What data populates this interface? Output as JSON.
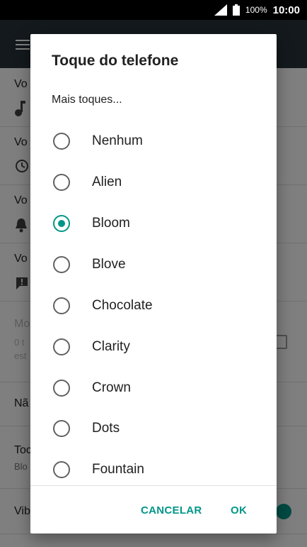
{
  "status_bar": {
    "battery": "100%",
    "time": "10:00"
  },
  "background": {
    "rows": [
      {
        "title": "Vo"
      },
      {
        "title": "Vo"
      },
      {
        "title": "Vo"
      },
      {
        "title": "Vo"
      },
      {
        "title": "Mo",
        "sub1": "0 t",
        "sub2": "est"
      },
      {
        "title": "Nã"
      },
      {
        "title": "Toc",
        "sub1": "Blo"
      },
      {
        "title": "Vib"
      }
    ]
  },
  "dialog": {
    "title": "Toque do telefone",
    "more_tones": "Mais toques...",
    "options": [
      {
        "label": "Nenhum",
        "checked": false
      },
      {
        "label": "Alien",
        "checked": false
      },
      {
        "label": "Bloom",
        "checked": true
      },
      {
        "label": "Blove",
        "checked": false
      },
      {
        "label": "Chocolate",
        "checked": false
      },
      {
        "label": "Clarity",
        "checked": false
      },
      {
        "label": "Crown",
        "checked": false
      },
      {
        "label": "Dots",
        "checked": false
      },
      {
        "label": "Fountain",
        "checked": false
      }
    ],
    "cancel_label": "CANCELAR",
    "ok_label": "OK"
  },
  "colors": {
    "accent": "#009688",
    "appbar": "#263238"
  }
}
